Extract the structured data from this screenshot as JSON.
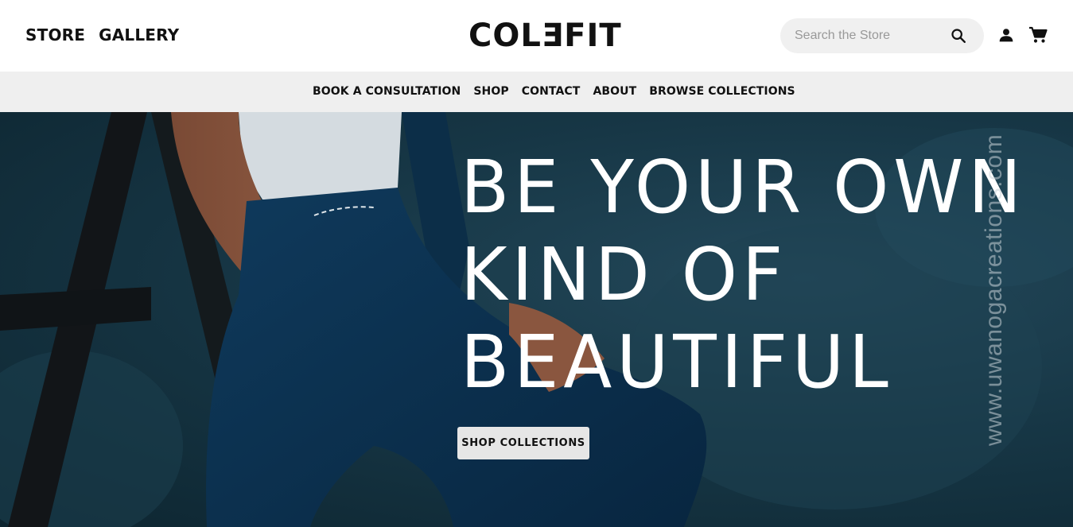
{
  "header": {
    "left_links": [
      {
        "label": "STORE"
      },
      {
        "label": "GALLERY"
      }
    ],
    "logo": "COLƎFIT",
    "search": {
      "placeholder": "Search the Store",
      "value": "",
      "icon": "search-icon"
    },
    "account_icon": "user-icon",
    "cart_icon": "cart-icon"
  },
  "nav": {
    "items": [
      {
        "label": "BOOK A CONSULTATION"
      },
      {
        "label": "SHOP"
      },
      {
        "label": "CONTACT"
      },
      {
        "label": "ABOUT"
      },
      {
        "label": "BROWSE COLLECTIONS"
      }
    ]
  },
  "hero": {
    "headline_lines": [
      "BE YOUR OWN",
      "KIND OF",
      "BEAUTIFUL"
    ],
    "cta_label": "SHOP COLLECTIONS",
    "watermark": "www.uwanogacreations.com",
    "colors": {
      "background": "#173746",
      "headline": "#ffffff",
      "cta_bg": "#e6e6e6"
    }
  }
}
